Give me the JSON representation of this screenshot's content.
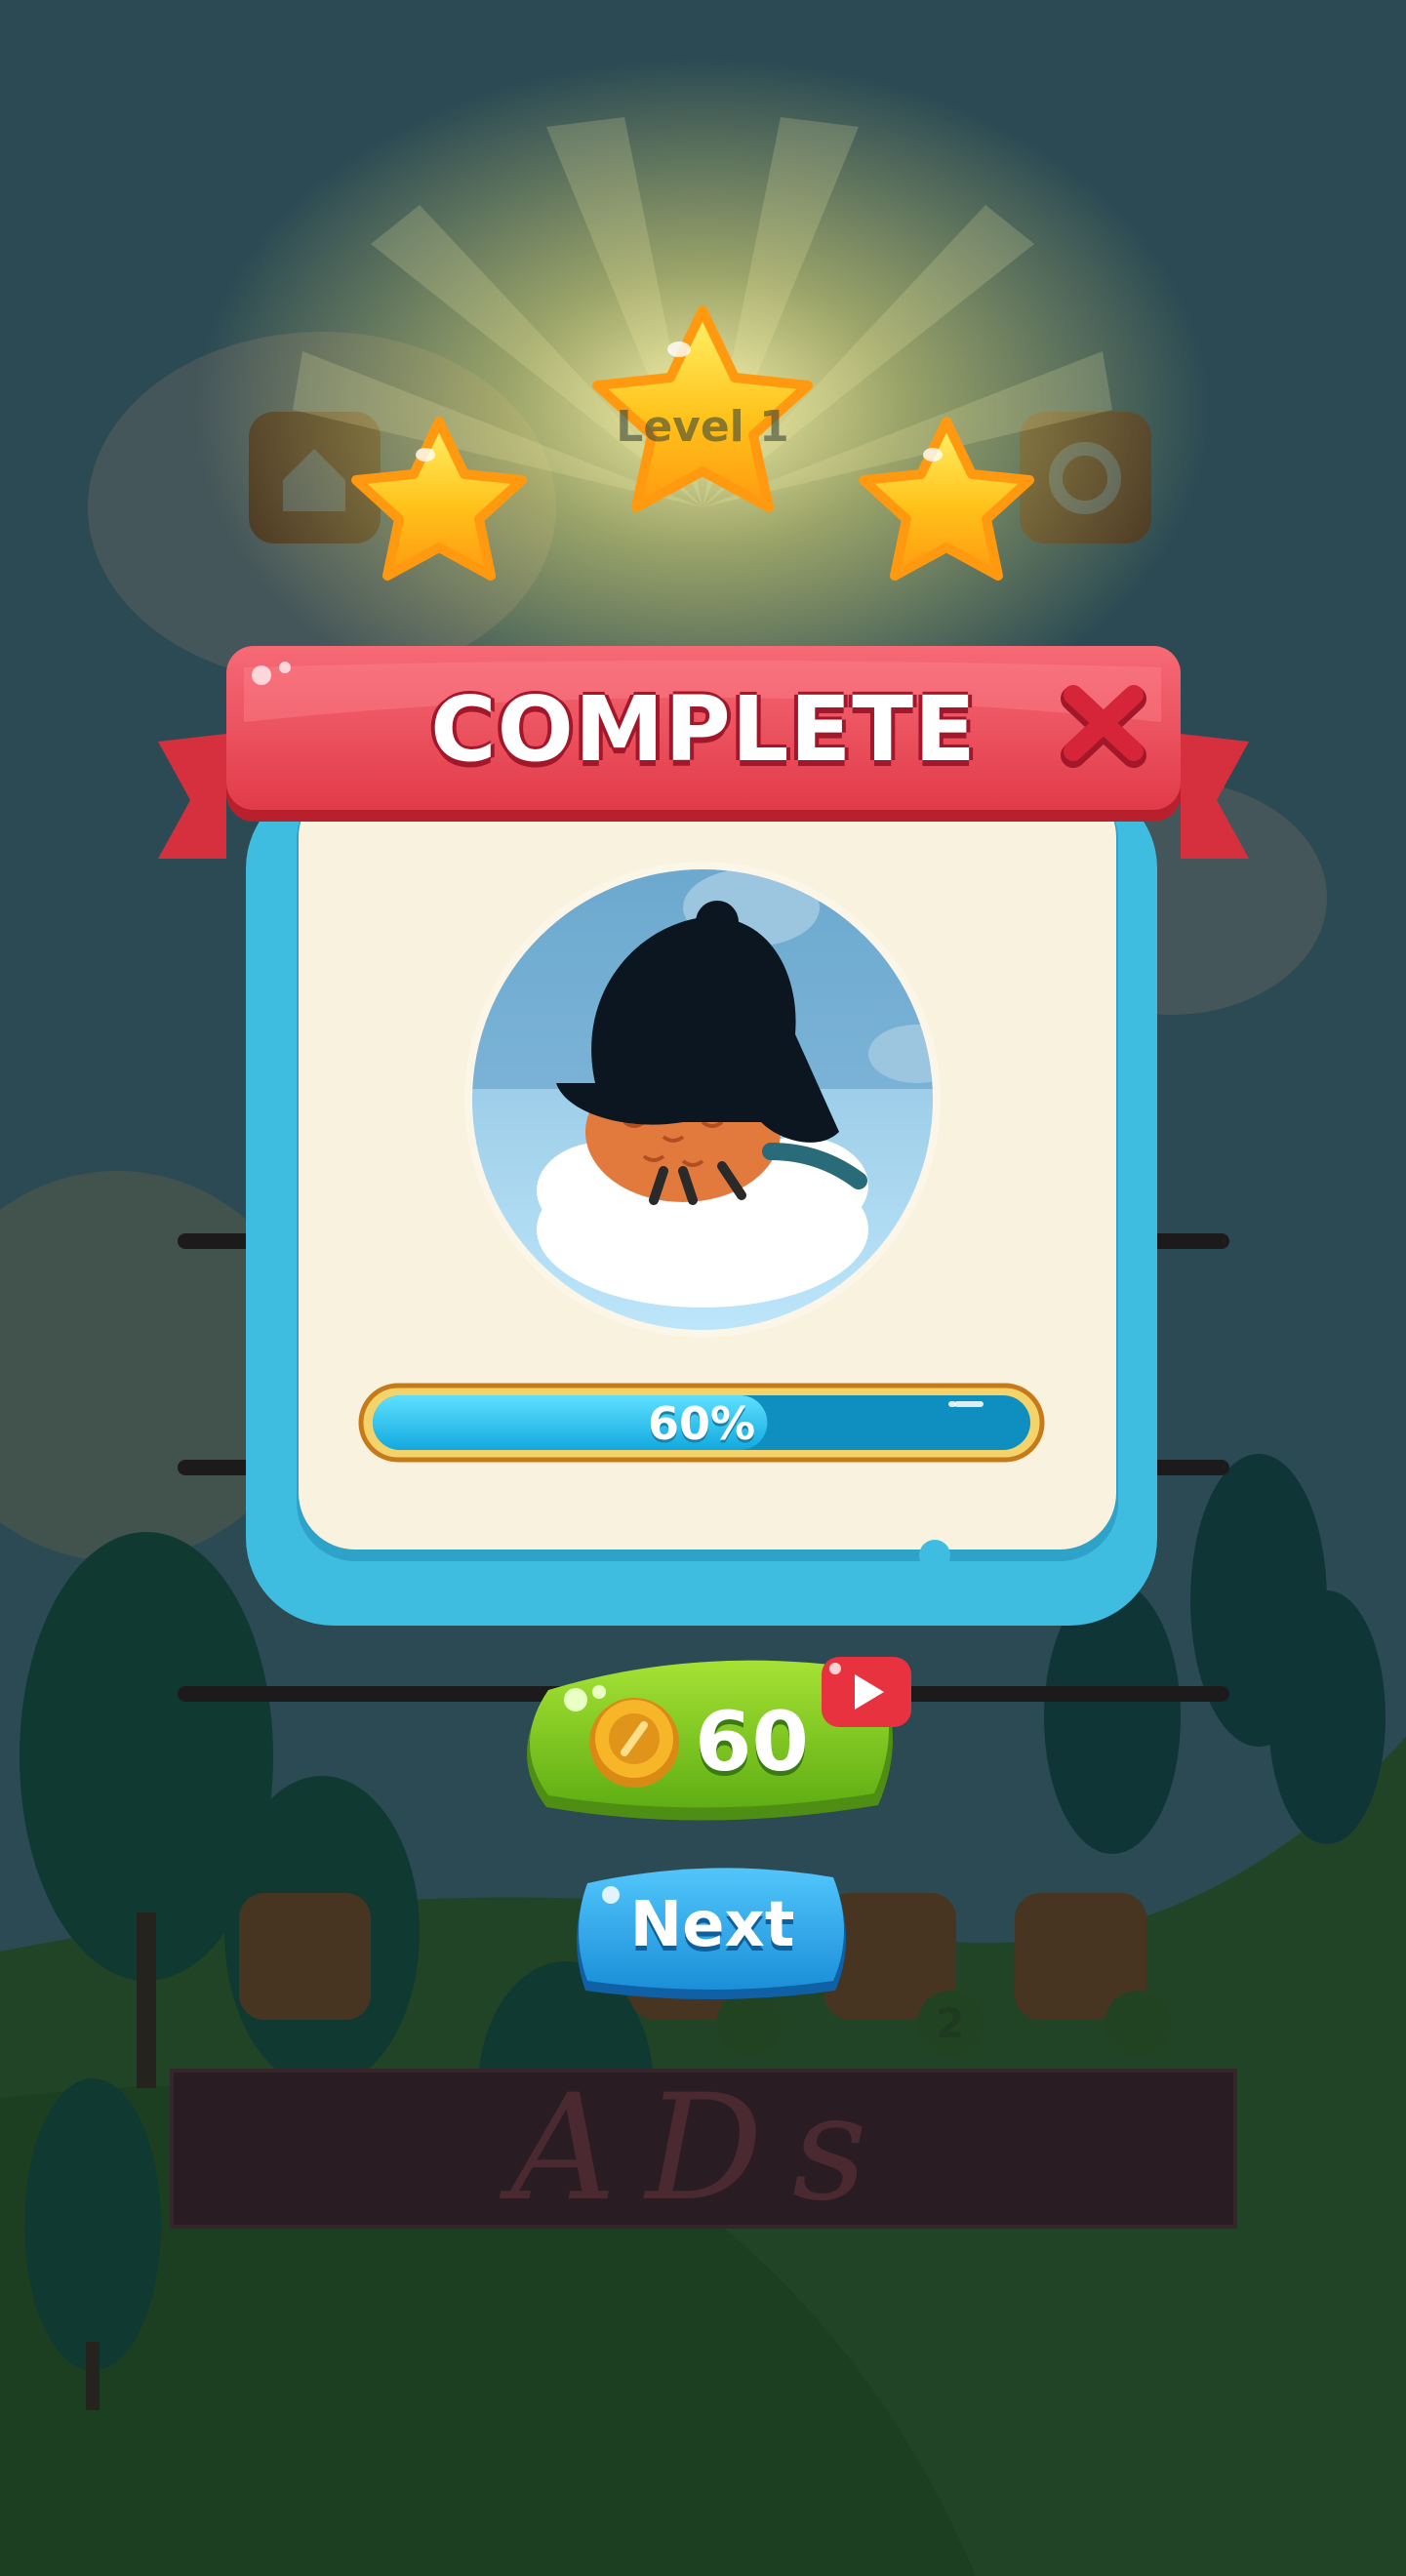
{
  "popup": {
    "title": "COMPLETE",
    "progress": 0.6,
    "progress_text": "60%",
    "stars_earned": 3,
    "reward": {
      "amount": "60",
      "icon": "coin-icon",
      "video_badge_icon": "play-video-icon"
    },
    "next_label": "Next",
    "close_icon": "close-icon"
  },
  "background": {
    "level_label": "Level 1",
    "top_buttons": [
      "home-icon",
      "restart-icon"
    ],
    "bottom_buttons": [
      "shop-icon",
      "hint-icon",
      "undo-icon",
      "skip-icon"
    ],
    "hint_count": "2",
    "ads_label": "ADs"
  },
  "colors": {
    "banner_red": "#ee4b58",
    "frame_blue": "#3fbde0",
    "paper": "#f8f2de",
    "progress_cyan": "#2cc8f0",
    "button_green": "#7fcb22",
    "button_blue": "#2fa6ea",
    "star_yellow": "#ffc21a"
  }
}
